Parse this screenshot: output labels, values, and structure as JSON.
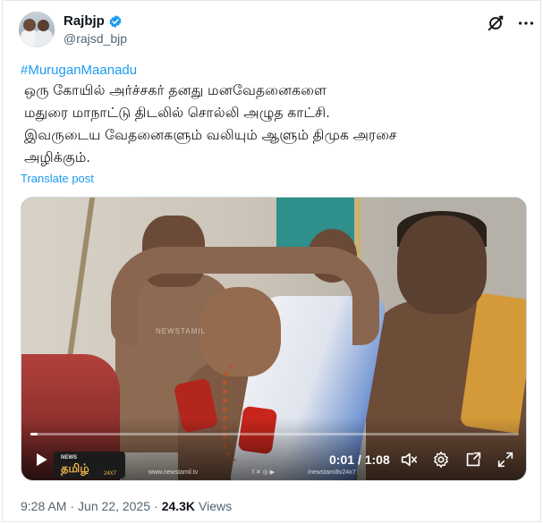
{
  "author": {
    "display_name": "Rajbjp",
    "handle": "@rajsd_bjp",
    "verified_color": "#1d9bf0"
  },
  "tweet": {
    "hashtag": "#MuruganMaanadu",
    "lines": [
      "ஒரு கோயில் அர்ச்சகர்  தனது மனவேதனைகளை",
      "மதுரை மாநாட்டு திடலில் சொல்லி அழுத காட்சி.",
      "இவருடைய வேதனைகளும் வலியும் ஆளும் திமுக அரசை",
      "அழிக்கும்."
    ],
    "translate_label": "Translate post"
  },
  "video": {
    "current_time": "0:01",
    "separator": " / ",
    "duration": "1:08",
    "progress_fraction": 0.015,
    "watermark": "NEWSTAMIL",
    "logo_news": "NEWS",
    "logo_tamil": "தமிழ்",
    "logo_247": "24X7",
    "site_url": "www.newstamil.tv",
    "social_handle": "/newstamiltv24x7"
  },
  "meta": {
    "time": "9:28 AM",
    "dot": "·",
    "date": "Jun 22, 2025",
    "dot2": "·",
    "views_count": "24.3K",
    "views_label": "Views"
  },
  "colors": {
    "accent": "#1d9bf0",
    "text": "#0f1419",
    "muted": "#536471"
  },
  "icons": [
    "verified-badge-icon",
    "grok-icon",
    "more-icon",
    "play-icon",
    "mute-icon",
    "settings-icon",
    "pip-icon",
    "fullscreen-icon"
  ]
}
